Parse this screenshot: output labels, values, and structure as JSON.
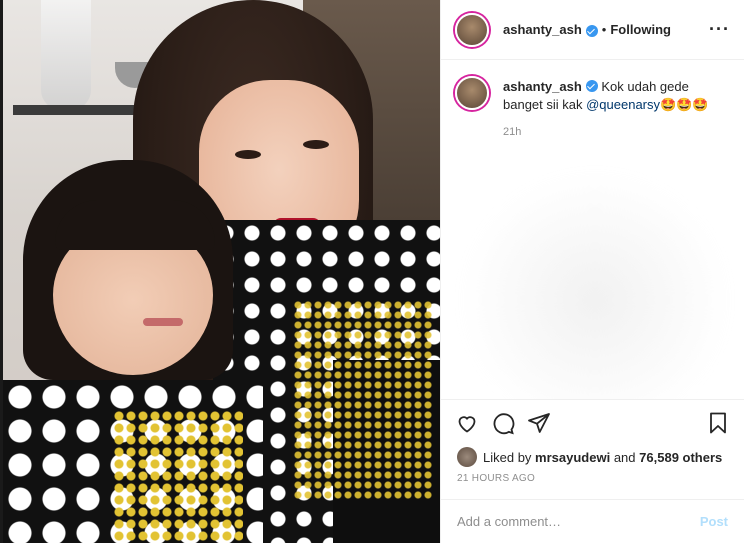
{
  "header": {
    "username": "ashanty_ash",
    "separator": "•",
    "follow_status": "Following",
    "more_icon": "more-horizontal-icon"
  },
  "comments": [
    {
      "username": "ashanty_ash",
      "text_before": "Kok udah gede banget sii kak ",
      "mention": "@queenarsy",
      "emoji": "🤩🤩🤩",
      "time": "21h"
    }
  ],
  "actions": {
    "like_icon": "heart-icon",
    "comment_icon": "comment-icon",
    "share_icon": "paper-plane-icon",
    "save_icon": "bookmark-icon"
  },
  "likes": {
    "prefix": "Liked by",
    "user": "mrsayudewi",
    "conjunction": "and",
    "others": "76,589 others"
  },
  "posted_ago": "21 HOURS AGO",
  "add_comment": {
    "placeholder": "Add a comment…",
    "post_label": "Post"
  },
  "colors": {
    "verified": "#3897f0",
    "post_button": "#b2dffc",
    "mention": "#00376b"
  }
}
